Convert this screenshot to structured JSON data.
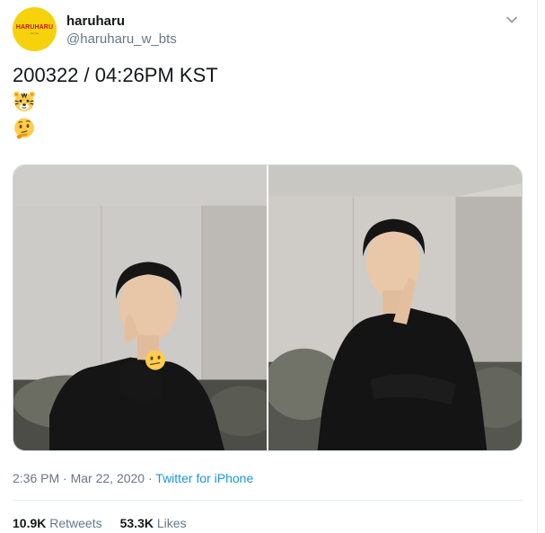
{
  "user": {
    "display_name": "haruharu",
    "handle": "@haruharu_w_bts",
    "avatar_text": "HARUHARU",
    "avatar_subtext": "for you",
    "avatar_color": "#f5d20c"
  },
  "tweet": {
    "text": "200322 / 04:26PM KST",
    "emojis": [
      "tiger-face-emoji",
      "thinking-face-emoji"
    ]
  },
  "media": {
    "photos": [
      {
        "name": "photo-left",
        "sticker": "thinking-face-emoji"
      },
      {
        "name": "photo-right"
      }
    ]
  },
  "meta": {
    "time": "2:36 PM",
    "separator1": " · ",
    "date": "Mar 22, 2020",
    "separator2": " · ",
    "source": "Twitter for iPhone"
  },
  "stats": {
    "retweets_count": "10.9K",
    "retweets_label": "Retweets",
    "likes_count": "53.3K",
    "likes_label": "Likes"
  },
  "colors": {
    "link": "#1b95e0",
    "muted": "#657786",
    "text": "#14171a"
  }
}
